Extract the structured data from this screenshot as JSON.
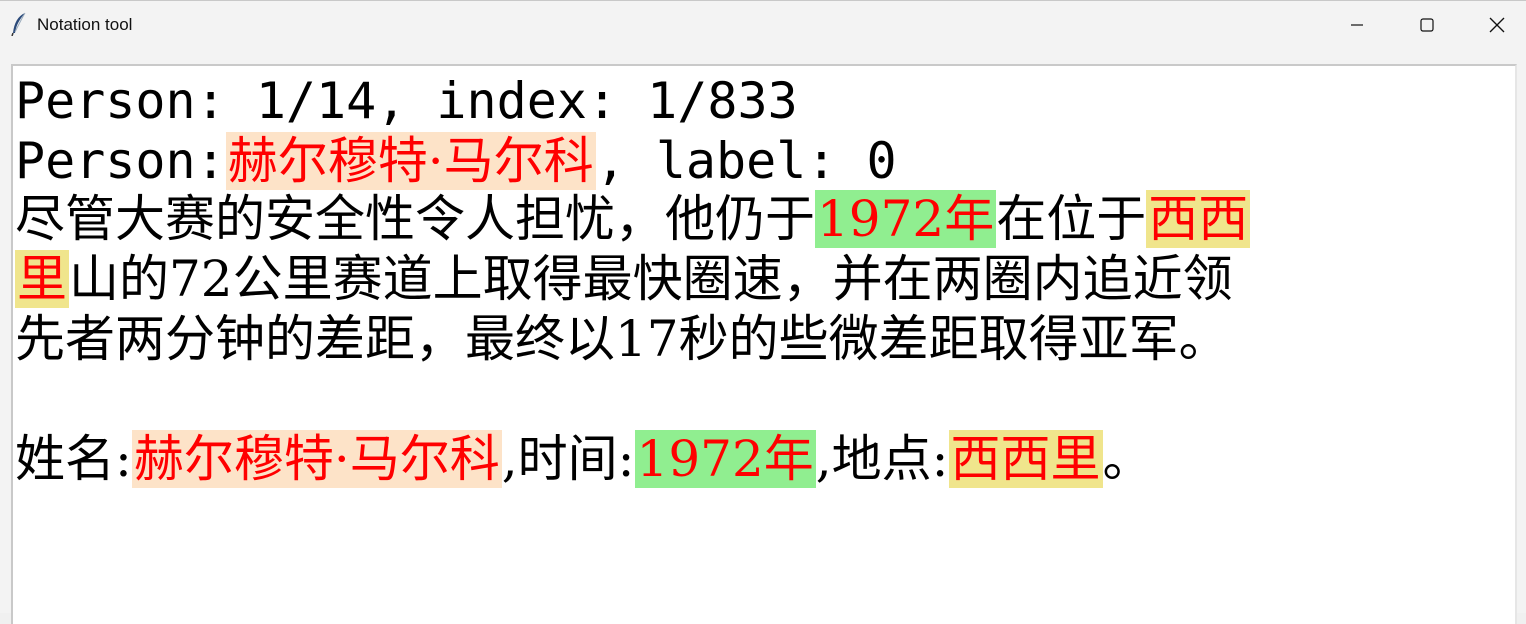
{
  "window": {
    "title": "Notation tool",
    "app_icon": "feather-icon",
    "controls": {
      "minimize_icon": "minimize-icon",
      "maximize_icon": "maximize-icon",
      "close_icon": "close-icon"
    }
  },
  "content": {
    "line1": "Person: 1/14, index: 1/833",
    "line2": {
      "prefix": "Person:",
      "person": "赫尔穆特·马尔科",
      "suffix": ", label: 0"
    },
    "sentence": {
      "part1": "尽管大赛的安全性令人担忧，他仍于",
      "time": "1972年",
      "part2": "在位于",
      "place_a": "西西",
      "place_b": "里",
      "part3": "山的72公里赛道上取得最快圈速，并在两圈内追近领",
      "part4": "先者两分钟的差距，最终以17秒的些微差距取得亚军。"
    },
    "summary": {
      "name_label": "姓名:",
      "name": "赫尔穆特·马尔科",
      "time_label": ",时间:",
      "time": "1972年",
      "place_label": ",地点:",
      "place": "西西里",
      "end": "。"
    }
  },
  "colors": {
    "highlight_text": "#ff0000",
    "person_bg": "#fde3c8",
    "time_bg": "#90ee90",
    "place_bg": "#f0e58c"
  }
}
